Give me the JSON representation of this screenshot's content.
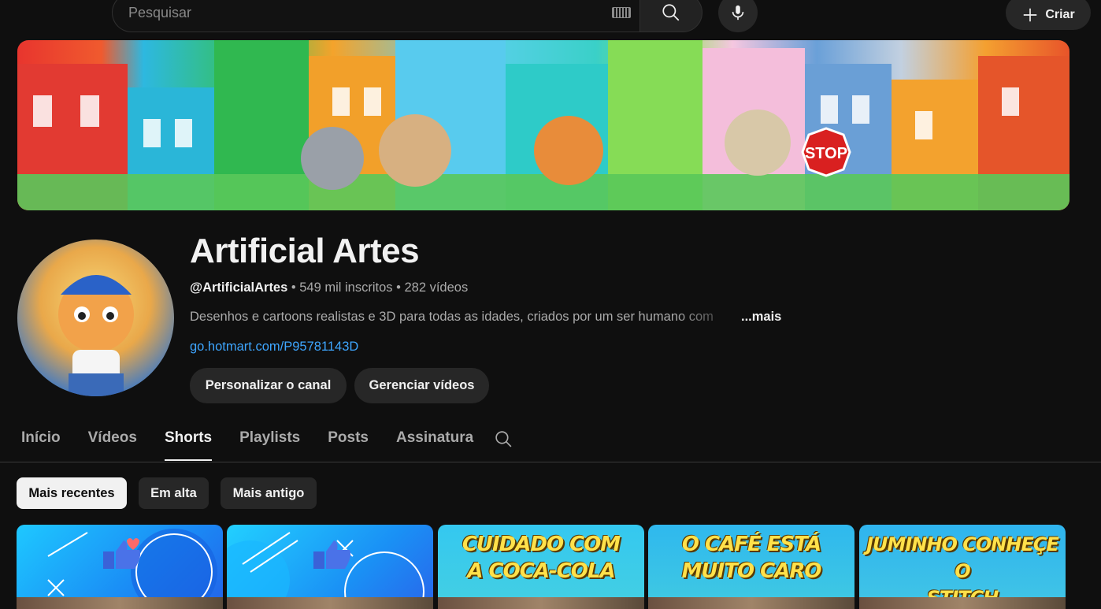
{
  "topbar": {
    "search_placeholder": "Pesquisar",
    "create_label": "Criar"
  },
  "channel": {
    "name": "Artificial Artes",
    "handle": "@ArtificialArtes",
    "subscribers": " • 549 mil inscritos",
    "videos": " • 282 vídeos",
    "description": "Desenhos e cartoons realistas e 3D para todas as idades, criados por um ser humano com",
    "more_label": "...mais",
    "link": "go.hotmart.com/P95781143D",
    "personalize_label": "Personalizar o canal",
    "manage_label": "Gerenciar vídeos"
  },
  "tabs": [
    {
      "label": "Início"
    },
    {
      "label": "Vídeos"
    },
    {
      "label": "Shorts",
      "active": true
    },
    {
      "label": "Playlists"
    },
    {
      "label": "Posts"
    },
    {
      "label": "Assinatura"
    }
  ],
  "chips": [
    {
      "label": "Mais recentes",
      "selected": true
    },
    {
      "label": "Em alta"
    },
    {
      "label": "Mais antigo"
    }
  ],
  "shorts": [
    {
      "title": ""
    },
    {
      "title": ""
    },
    {
      "title": "CUIDADO COM\nA COCA-COLA"
    },
    {
      "title": "O CAFÉ ESTÁ\nMUITO CARO"
    },
    {
      "title": "JUMINHO CONHEÇE O\nSTITCH"
    }
  ],
  "colors": {
    "background": "#0f0f0f",
    "link": "#3ea6ff",
    "chip_selected": "#f1f1f1",
    "button": "#272727",
    "thumb_title": "#ffe14a"
  }
}
